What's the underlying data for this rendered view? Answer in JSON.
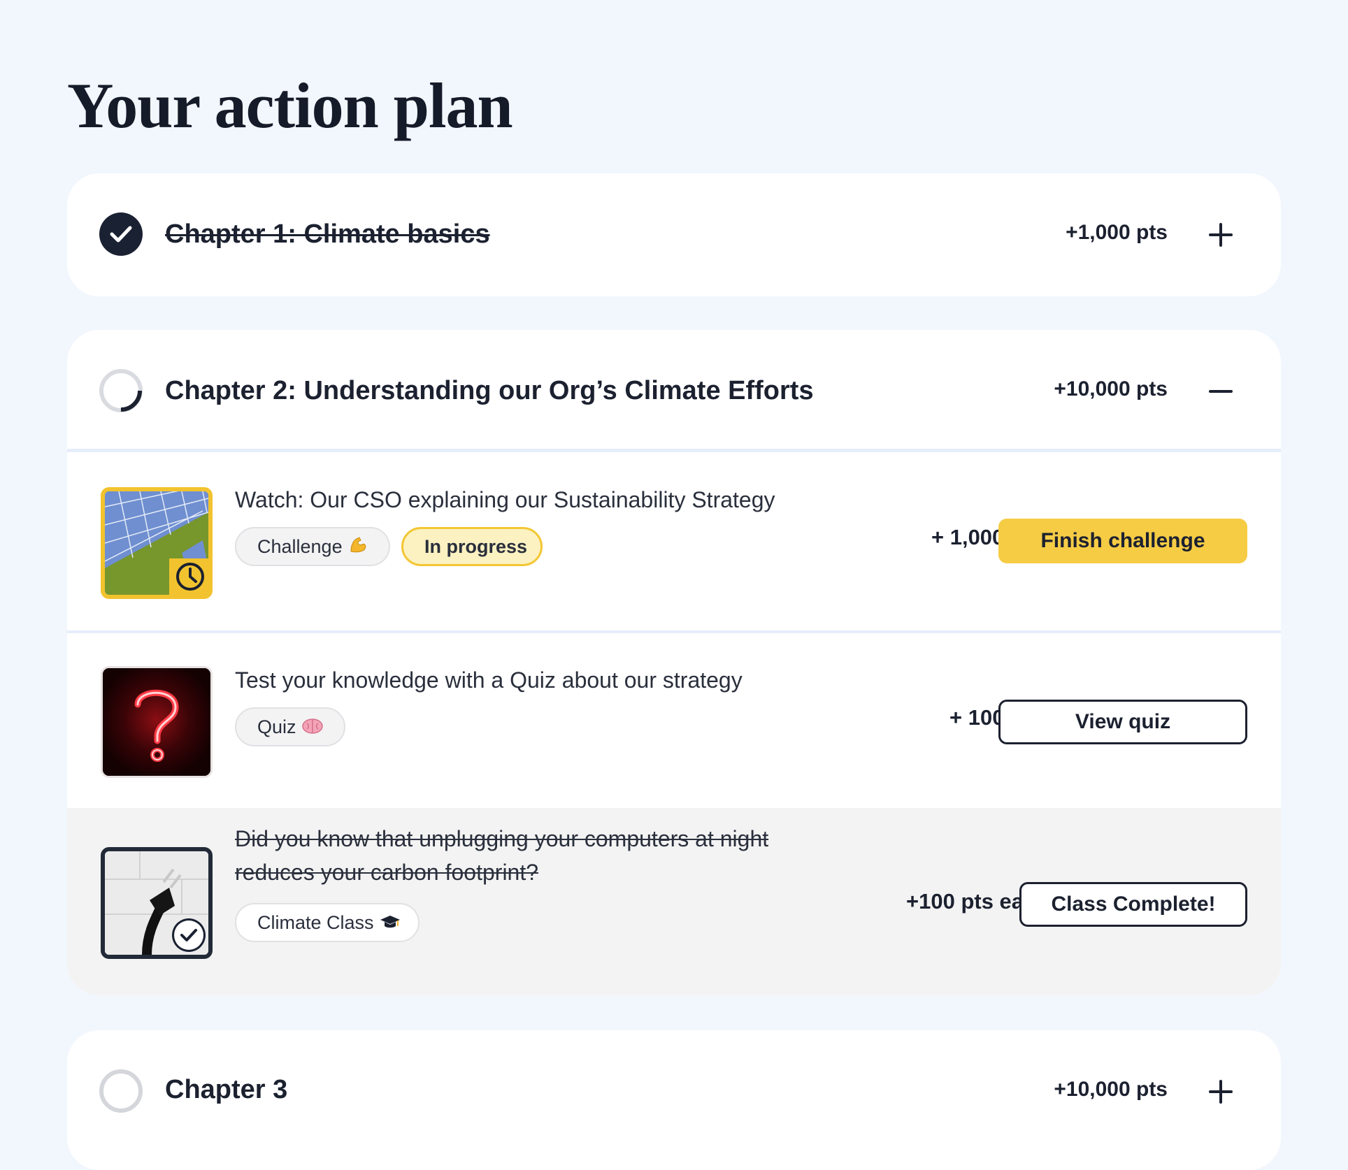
{
  "page": {
    "title": "Your action plan"
  },
  "chapters": [
    {
      "title": "Chapter 1: Climate basics",
      "points": "+1,000 pts",
      "status": "complete",
      "toggle": "expand"
    },
    {
      "title": "Chapter 2: Understanding our Org’s Climate Efforts",
      "points": "+10,000 pts",
      "status": "in-progress",
      "toggle": "collapse",
      "tasks": [
        {
          "title": "Watch: Our CSO explaining our Sustainability Strategy",
          "tags": [
            "Challenge",
            "In progress"
          ],
          "points": "+ 1,000 pts",
          "button": "Finish challenge",
          "thumb_icon": "clock-icon"
        },
        {
          "title": "Test your knowledge with a Quiz about our strategy",
          "tags": [
            "Quiz"
          ],
          "points": "+ 100 pts",
          "button": "View quiz"
        },
        {
          "title_line1": "Did you know that unplugging your computers at night",
          "title_line2": "reduces your carbon footprint?",
          "tags": [
            "Climate Class"
          ],
          "points": "+100 pts earned",
          "button": "Class Complete!",
          "thumb_icon": "check-icon"
        }
      ]
    },
    {
      "title": "Chapter 3",
      "points": "+10,000 pts",
      "status": "not-started",
      "toggle": "expand"
    }
  ],
  "colors": {
    "accent": "#f6cc45",
    "dark": "#1a2132",
    "background": "#f2f6fd"
  }
}
